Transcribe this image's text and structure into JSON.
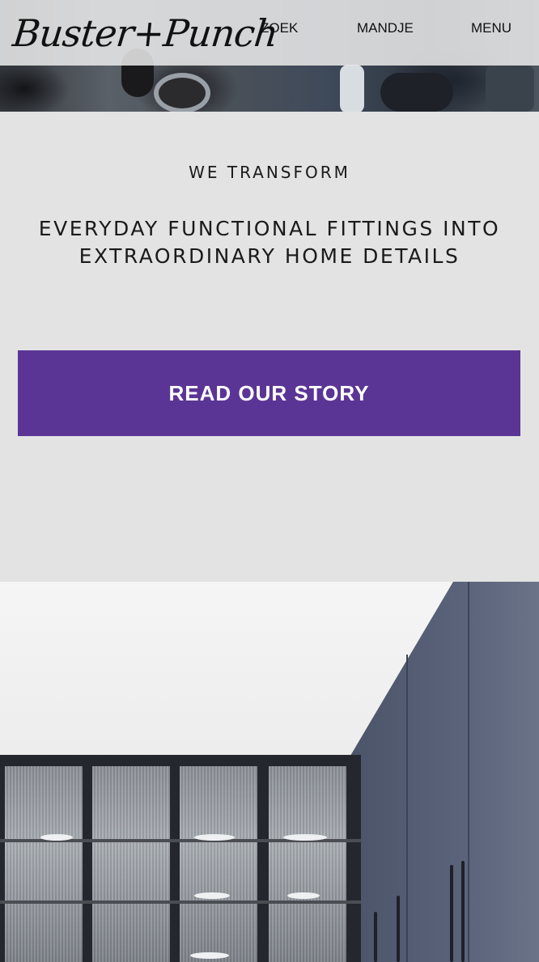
{
  "header": {
    "logo_text": "Buster+Punch",
    "nav": {
      "search_label": "ZOEK",
      "cart_label": "MANDJE",
      "menu_label": "MENU"
    }
  },
  "intro": {
    "eyebrow": "WE TRANSFORM",
    "headline": "EVERYDAY FUNCTIONAL FITTINGS INTO EXTRAORDINARY HOME DETAILS",
    "cta_label": "READ OUR STORY"
  },
  "colors": {
    "accent": "#5b3595",
    "background": "#e3e3e3",
    "header_bg": "#ebebeb"
  }
}
